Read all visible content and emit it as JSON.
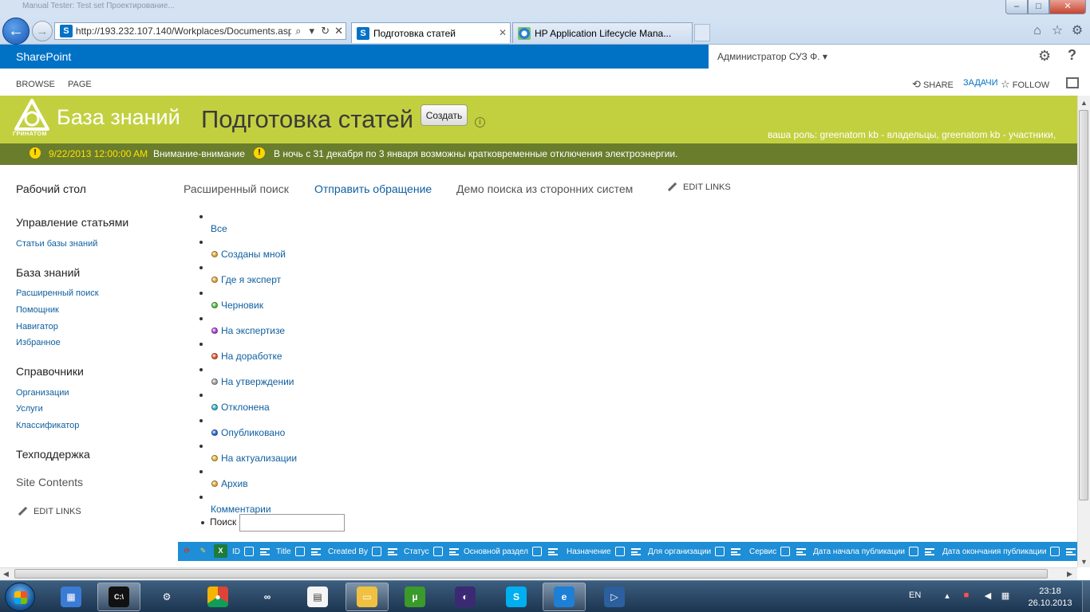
{
  "browser": {
    "window_title_ghost": "Manual Tester: Test set Проектирование...",
    "url": "http://193.232.107.140/Workplaces/Documents.asp",
    "tabs": [
      {
        "label": "Подготовка статей",
        "active": true,
        "icon": "sharepoint-icon"
      },
      {
        "label": "HP Application Lifecycle Mana...",
        "active": false,
        "icon": "ie-loading-icon"
      }
    ],
    "window_buttons": {
      "minimize": "–",
      "maximize": "□",
      "close": "✕"
    }
  },
  "suite": {
    "brand": "SharePoint",
    "user": "Администратор СУЗ Ф. ▾"
  },
  "ribbon": {
    "tabs": [
      "BROWSE",
      "PAGE"
    ],
    "share": "SHARE",
    "tasks": "ЗАДАЧИ",
    "follow": "FOLLOW"
  },
  "header": {
    "logo_caption": "ГРИНАТОМ",
    "site_name": "База знаний",
    "page_title": "Подготовка статей",
    "create_button": "Создать",
    "role_text": "ваша роль: greenatom kb - владельцы, greenatom kb - участники,"
  },
  "announcement": {
    "date": "9/22/2013 12:00:00 AM",
    "title": "Внимание-внимание",
    "message": "В ночь с 31 декабря по 3 января возможны кратковременные отключения электроэнергии."
  },
  "leftnav": {
    "desk": "Рабочий стол",
    "manage": "Управление статьями",
    "manage_items": [
      "Статьи базы знаний"
    ],
    "kb": "База знаний",
    "kb_items": [
      "Расширенный поиск",
      "Помощник",
      "Навигатор",
      "Избранное"
    ],
    "refs": "Справочники",
    "refs_items": [
      "Организации",
      "Услуги",
      "Классификатор"
    ],
    "support": "Техподдержка",
    "site_contents": "Site Contents",
    "edit_links": "EDIT LINKS"
  },
  "topnav": {
    "items": [
      "Расширенный поиск",
      "Отправить обращение",
      "Демо поиска из сторонних систем"
    ],
    "edit_links": "EDIT LINKS"
  },
  "status_filters": [
    {
      "label": "Все",
      "color": ""
    },
    {
      "label": "Созданы мной",
      "color": "#e0a030"
    },
    {
      "label": "Где я эксперт",
      "color": "#e0a030"
    },
    {
      "label": "Черновик",
      "color": "#4cbb3a"
    },
    {
      "label": "На экспертизе",
      "color": "#a23ad0"
    },
    {
      "label": "На доработке",
      "color": "#e05028"
    },
    {
      "label": "На утверждении",
      "color": "#9a9a9a"
    },
    {
      "label": "Отклонена",
      "color": "#2ab0c0"
    },
    {
      "label": "Опубликовано",
      "color": "#2060d8"
    },
    {
      "label": "На актуализации",
      "color": "#e0b030"
    },
    {
      "label": "Архив",
      "color": "#e0a030"
    },
    {
      "label": "Комментарии",
      "color": ""
    }
  ],
  "search": {
    "label": "Поиск",
    "value": ""
  },
  "grid_columns": [
    "ID",
    "Title",
    "Created By",
    "Статус",
    "Основной раздел",
    "Назначение",
    "Для организации",
    "Сервис",
    "Дата начала публикации",
    "Дата окончания публикации"
  ],
  "taskbar": {
    "language": "EN",
    "time": "23:18",
    "date": "26.10.2013",
    "apps": [
      "control-panel-icon",
      "cmd-icon",
      "settings-icon",
      "chrome-icon",
      "visual-studio-icon",
      "chart-app-icon",
      "explorer-icon",
      "utorrent-icon",
      "eclipse-icon",
      "skype-icon",
      "ie-icon",
      "media-player-icon"
    ]
  }
}
